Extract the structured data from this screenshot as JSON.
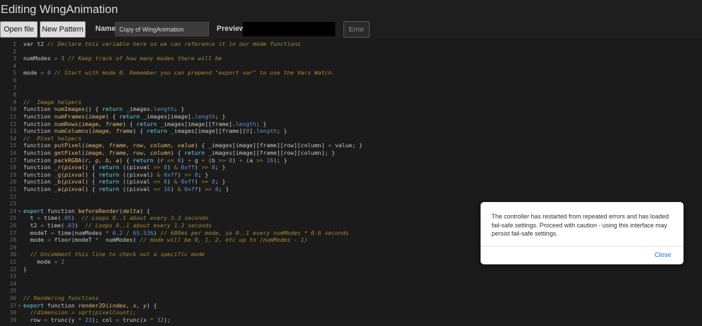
{
  "title": "Editing WingAnimation",
  "toolbar": {
    "open_file": "Open file",
    "new_pattern": "New Pattern",
    "name_label": "Name",
    "name_value": "Copy of WingAnimation",
    "preview_label": "Preview",
    "error_label": "Error"
  },
  "colors": {
    "keyword": "#66d9ef",
    "function": "#e9b96e",
    "comment": "#a3892e",
    "number": "#5f8fd0",
    "default": "#c8c8c8",
    "param": "#e9b96e"
  },
  "editor": {
    "lines": [
      {
        "n": "1",
        "fold": "",
        "tokens": [
          [
            "var t2 ",
            "d"
          ],
          [
            "// Declare this variable here so we can reference it in our mode functions",
            "c"
          ]
        ]
      },
      {
        "n": "2",
        "fold": "",
        "tokens": []
      },
      {
        "n": "3",
        "fold": "",
        "tokens": [
          [
            "numModes ",
            "d"
          ],
          [
            "= ",
            "o"
          ],
          [
            "3",
            "n"
          ],
          [
            " ",
            "d"
          ],
          [
            "// Keep track of how many modes there will be",
            "c"
          ]
        ]
      },
      {
        "n": "4",
        "fold": "",
        "tokens": []
      },
      {
        "n": "5",
        "fold": "",
        "tokens": [
          [
            "mode ",
            "d"
          ],
          [
            "= ",
            "o"
          ],
          [
            "0",
            "n"
          ],
          [
            " ",
            "d"
          ],
          [
            "// Start with mode 0. Remember you can prepend \"export var\" to use the Vars Watch.",
            "c"
          ]
        ]
      },
      {
        "n": "6",
        "fold": "",
        "tokens": []
      },
      {
        "n": "7",
        "fold": "",
        "tokens": []
      },
      {
        "n": "8",
        "fold": "",
        "tokens": []
      },
      {
        "n": "9",
        "fold": "",
        "tokens": [
          [
            "//  Image helpers",
            "c"
          ]
        ]
      },
      {
        "n": "10",
        "fold": "",
        "tokens": [
          [
            "function ",
            "d"
          ],
          [
            "numImages",
            "f"
          ],
          [
            "() { ",
            "d"
          ],
          [
            "return",
            "k"
          ],
          [
            " _images.",
            "d"
          ],
          [
            "length",
            "n"
          ],
          [
            "; }",
            "d"
          ]
        ]
      },
      {
        "n": "11",
        "fold": "",
        "tokens": [
          [
            "function ",
            "d"
          ],
          [
            "numFrames",
            "f"
          ],
          [
            "(",
            "d"
          ],
          [
            "image",
            "p"
          ],
          [
            ") { ",
            "d"
          ],
          [
            "return",
            "k"
          ],
          [
            " _images[image].",
            "d"
          ],
          [
            "length",
            "n"
          ],
          [
            "; }",
            "d"
          ]
        ]
      },
      {
        "n": "12",
        "fold": "",
        "tokens": [
          [
            "function ",
            "d"
          ],
          [
            "numRows",
            "f"
          ],
          [
            "(",
            "d"
          ],
          [
            "image, frame",
            "p"
          ],
          [
            ") { ",
            "d"
          ],
          [
            "return",
            "k"
          ],
          [
            " _images[image][frame].",
            "d"
          ],
          [
            "length",
            "n"
          ],
          [
            "; }",
            "d"
          ]
        ]
      },
      {
        "n": "13",
        "fold": "",
        "tokens": [
          [
            "function ",
            "d"
          ],
          [
            "numColumns",
            "f"
          ],
          [
            "(",
            "d"
          ],
          [
            "image, frame",
            "p"
          ],
          [
            ") { ",
            "d"
          ],
          [
            "return",
            "k"
          ],
          [
            " _images[image][frame][",
            "d"
          ],
          [
            "0",
            "n"
          ],
          [
            "].",
            "d"
          ],
          [
            "length",
            "n"
          ],
          [
            "; }",
            "d"
          ]
        ]
      },
      {
        "n": "14",
        "fold": "",
        "tokens": [
          [
            "//  Pixel helpers",
            "c"
          ]
        ]
      },
      {
        "n": "15",
        "fold": "",
        "tokens": [
          [
            "function ",
            "d"
          ],
          [
            "putPixel",
            "f"
          ],
          [
            "(",
            "d"
          ],
          [
            "image, frame, row, column, value",
            "p"
          ],
          [
            ") { _images[image][frame][row][column] ",
            "d"
          ],
          [
            "=",
            "o"
          ],
          [
            " value; }",
            "d"
          ]
        ]
      },
      {
        "n": "16",
        "fold": "",
        "tokens": [
          [
            "function ",
            "d"
          ],
          [
            "getPixel",
            "f"
          ],
          [
            "(",
            "d"
          ],
          [
            "image, frame, row, column",
            "p"
          ],
          [
            ") { ",
            "d"
          ],
          [
            "return",
            "k"
          ],
          [
            " _images[image][frame][row][column]; }",
            "d"
          ]
        ]
      },
      {
        "n": "17",
        "fold": "",
        "tokens": [
          [
            "function ",
            "d"
          ],
          [
            "packRGBA",
            "f"
          ],
          [
            "(",
            "d"
          ],
          [
            "r, g, b, a",
            "p"
          ],
          [
            ") { ",
            "d"
          ],
          [
            "return",
            "k"
          ],
          [
            " (r ",
            "d"
          ],
          [
            "<<",
            "o"
          ],
          [
            " ",
            "d"
          ],
          [
            "8",
            "n"
          ],
          [
            ") ",
            "d"
          ],
          [
            "+",
            "o"
          ],
          [
            " g ",
            "d"
          ],
          [
            "+",
            "o"
          ],
          [
            " (b ",
            "d"
          ],
          [
            ">>",
            "o"
          ],
          [
            " ",
            "d"
          ],
          [
            "8",
            "n"
          ],
          [
            ") ",
            "d"
          ],
          [
            "+",
            "o"
          ],
          [
            " (a ",
            "d"
          ],
          [
            ">>",
            "o"
          ],
          [
            " ",
            "d"
          ],
          [
            "16",
            "n"
          ],
          [
            "); }",
            "d"
          ]
        ]
      },
      {
        "n": "18",
        "fold": "",
        "tokens": [
          [
            "function ",
            "d"
          ],
          [
            "_r",
            "f"
          ],
          [
            "(",
            "d"
          ],
          [
            "pixval",
            "p"
          ],
          [
            ") { ",
            "d"
          ],
          [
            "return",
            "k"
          ],
          [
            " ((pixval ",
            "d"
          ],
          [
            ">>",
            "o"
          ],
          [
            " ",
            "d"
          ],
          [
            "8",
            "n"
          ],
          [
            ") ",
            "d"
          ],
          [
            "&",
            "o"
          ],
          [
            " ",
            "d"
          ],
          [
            "0xff",
            "n"
          ],
          [
            ") ",
            "d"
          ],
          [
            ">>",
            "o"
          ],
          [
            " ",
            "d"
          ],
          [
            "8",
            "n"
          ],
          [
            "; }",
            "d"
          ]
        ]
      },
      {
        "n": "19",
        "fold": "",
        "tokens": [
          [
            "function ",
            "d"
          ],
          [
            "_g",
            "f"
          ],
          [
            "(",
            "d"
          ],
          [
            "pixval",
            "p"
          ],
          [
            ") { ",
            "d"
          ],
          [
            "return",
            "k"
          ],
          [
            " ((pixval) ",
            "d"
          ],
          [
            "&",
            "o"
          ],
          [
            " ",
            "d"
          ],
          [
            "0xff",
            "n"
          ],
          [
            ") ",
            "d"
          ],
          [
            ">>",
            "o"
          ],
          [
            " ",
            "d"
          ],
          [
            "8",
            "n"
          ],
          [
            "; }",
            "d"
          ]
        ]
      },
      {
        "n": "20",
        "fold": "",
        "tokens": [
          [
            "function ",
            "d"
          ],
          [
            "_b",
            "f"
          ],
          [
            "(",
            "d"
          ],
          [
            "pixval",
            "p"
          ],
          [
            ") { ",
            "d"
          ],
          [
            "return",
            "k"
          ],
          [
            " ((pixval ",
            "d"
          ],
          [
            "<<",
            "o"
          ],
          [
            " ",
            "d"
          ],
          [
            "8",
            "n"
          ],
          [
            ") ",
            "d"
          ],
          [
            "&",
            "o"
          ],
          [
            " ",
            "d"
          ],
          [
            "0xff",
            "n"
          ],
          [
            ") ",
            "d"
          ],
          [
            ">>",
            "o"
          ],
          [
            " ",
            "d"
          ],
          [
            "8",
            "n"
          ],
          [
            "; }",
            "d"
          ]
        ]
      },
      {
        "n": "21",
        "fold": "",
        "tokens": [
          [
            "function ",
            "d"
          ],
          [
            "_a",
            "f"
          ],
          [
            "(",
            "d"
          ],
          [
            "pixval",
            "p"
          ],
          [
            ") { ",
            "d"
          ],
          [
            "return",
            "k"
          ],
          [
            " ((pixval ",
            "d"
          ],
          [
            "<<",
            "o"
          ],
          [
            " ",
            "d"
          ],
          [
            "16",
            "n"
          ],
          [
            ") ",
            "d"
          ],
          [
            "&",
            "o"
          ],
          [
            " ",
            "d"
          ],
          [
            "0xff",
            "n"
          ],
          [
            ") ",
            "d"
          ],
          [
            ">>",
            "o"
          ],
          [
            " ",
            "d"
          ],
          [
            "8",
            "n"
          ],
          [
            "; }",
            "d"
          ]
        ]
      },
      {
        "n": "22",
        "fold": "",
        "tokens": []
      },
      {
        "n": "23",
        "fold": "",
        "tokens": []
      },
      {
        "n": "24",
        "fold": "▾",
        "tokens": [
          [
            "export",
            "k"
          ],
          [
            " function ",
            "d"
          ],
          [
            "beforeRender",
            "f"
          ],
          [
            "(",
            "d"
          ],
          [
            "delta",
            "p"
          ],
          [
            ") {",
            "d"
          ]
        ]
      },
      {
        "n": "25",
        "fold": "",
        "tokens": [
          [
            "  t ",
            "d"
          ],
          [
            "=",
            "o"
          ],
          [
            " time(",
            "d"
          ],
          [
            ".05",
            "n"
          ],
          [
            ")  ",
            "d"
          ],
          [
            "// Loops 0..1 about every 3.3 seconds",
            "c"
          ]
        ]
      },
      {
        "n": "26",
        "fold": "",
        "tokens": [
          [
            "  t2 ",
            "d"
          ],
          [
            "=",
            "o"
          ],
          [
            " time(",
            "d"
          ],
          [
            ".03",
            "n"
          ],
          [
            ")  ",
            "d"
          ],
          [
            "// Loops 0..1 about every 1.3 seconds",
            "c"
          ]
        ]
      },
      {
        "n": "27",
        "fold": "",
        "tokens": [
          [
            "  modeT ",
            "d"
          ],
          [
            "=",
            "o"
          ],
          [
            " time(numModes ",
            "d"
          ],
          [
            "*",
            "o"
          ],
          [
            " ",
            "d"
          ],
          [
            "0.2",
            "n"
          ],
          [
            " ",
            "d"
          ],
          [
            "/",
            "o"
          ],
          [
            " ",
            "d"
          ],
          [
            "65.536",
            "n"
          ],
          [
            ") ",
            "d"
          ],
          [
            "// 600ms per mode, so 0..1 every numModes * 0.6 seconds",
            "c"
          ]
        ]
      },
      {
        "n": "28",
        "fold": "",
        "tokens": [
          [
            "  mode ",
            "d"
          ],
          [
            "=",
            "o"
          ],
          [
            " floor(modeT ",
            "d"
          ],
          [
            "*",
            "o"
          ],
          [
            "  numModes) ",
            "d"
          ],
          [
            "// mode will be 0, 1, 2, etc up to (numModes - 1)",
            "c"
          ]
        ]
      },
      {
        "n": "29",
        "fold": "",
        "tokens": []
      },
      {
        "n": "30",
        "fold": "",
        "tokens": [
          [
            "  ",
            "d"
          ],
          [
            "// Uncomment this line to check out a specific mode",
            "c"
          ]
        ]
      },
      {
        "n": "31",
        "fold": "",
        "tokens": [
          [
            "    mode ",
            "d"
          ],
          [
            "=",
            "o"
          ],
          [
            " ",
            "d"
          ],
          [
            "2",
            "n"
          ]
        ]
      },
      {
        "n": "32",
        "fold": "",
        "tokens": [
          [
            "}",
            "d"
          ]
        ]
      },
      {
        "n": "33",
        "fold": "",
        "tokens": []
      },
      {
        "n": "34",
        "fold": "",
        "tokens": []
      },
      {
        "n": "35",
        "fold": "",
        "tokens": []
      },
      {
        "n": "36",
        "fold": "",
        "tokens": [
          [
            "// Rendering functions",
            "c"
          ]
        ]
      },
      {
        "n": "37",
        "fold": "▾",
        "tokens": [
          [
            "export",
            "k"
          ],
          [
            " function ",
            "d"
          ],
          [
            "render2D",
            "f"
          ],
          [
            "(",
            "d"
          ],
          [
            "index, x, y",
            "p"
          ],
          [
            ") {",
            "d"
          ]
        ]
      },
      {
        "n": "38",
        "fold": "",
        "tokens": [
          [
            "  ",
            "d"
          ],
          [
            "//dimension = sqrt(pixelCount);",
            "c"
          ]
        ]
      },
      {
        "n": "39",
        "fold": "",
        "tokens": [
          [
            "  row ",
            "d"
          ],
          [
            "=",
            "o"
          ],
          [
            " trunc(y ",
            "d"
          ],
          [
            "*",
            "o"
          ],
          [
            " ",
            "d"
          ],
          [
            "23",
            "n"
          ],
          [
            "); col ",
            "d"
          ],
          [
            "=",
            "o"
          ],
          [
            " trunc(x ",
            "d"
          ],
          [
            "*",
            "o"
          ],
          [
            " ",
            "d"
          ],
          [
            "32",
            "n"
          ],
          [
            ");",
            "d"
          ]
        ]
      }
    ]
  },
  "dialog": {
    "message": "The controller has restarted from repeated errors and has loaded fail-safe settings. Proceed with caution - using this interface may persist fail-safe settings.",
    "close_label": "Close"
  }
}
